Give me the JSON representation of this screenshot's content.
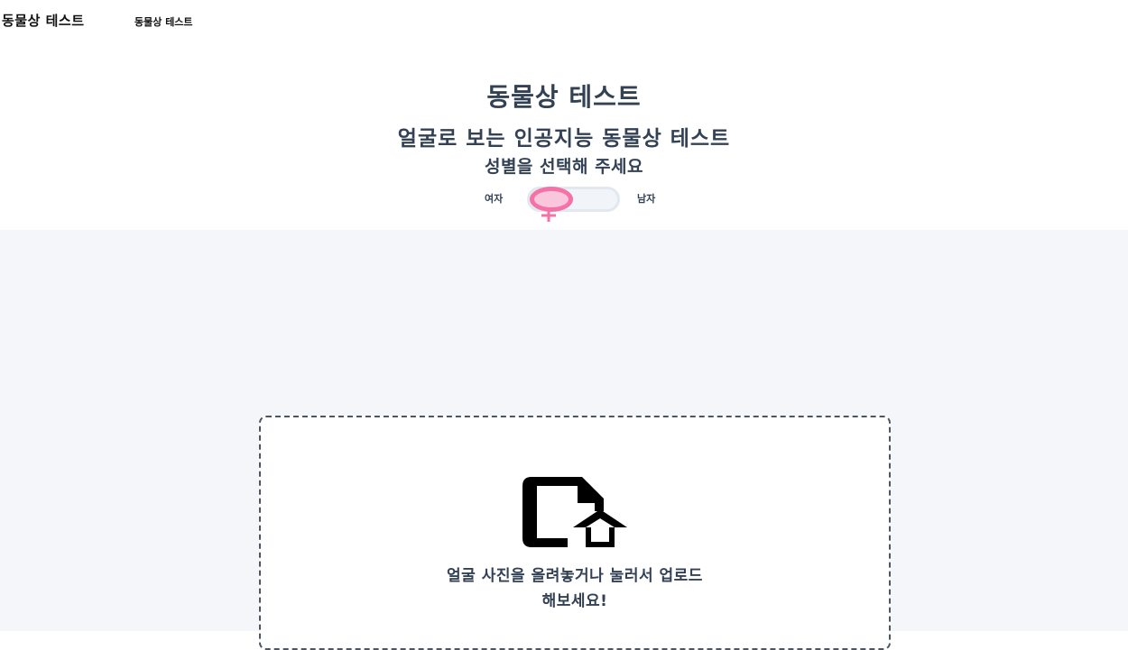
{
  "header": {
    "brand": "동물상 테스트",
    "nav_link": "동물상 테스트"
  },
  "hero": {
    "title": "동물상 테스트",
    "subtitle": "얼굴로 보는 인공지능 동물상 테스트",
    "prompt": "성별을 선택해 주세요",
    "gender_toggle": {
      "female_label": "여자",
      "male_label": "남자",
      "selected": "female",
      "female_icon": "female-symbol-icon"
    }
  },
  "upload": {
    "icon": "file-upload-icon",
    "line1": "얼굴 사진을 올려놓거나 눌러서 업로드",
    "line2": "해보세요!"
  },
  "colors": {
    "accent_pink": "#f472a8",
    "knob_fill": "#f9c6dc",
    "heading_text": "#334155",
    "page_bg": "#f5f6f9"
  }
}
